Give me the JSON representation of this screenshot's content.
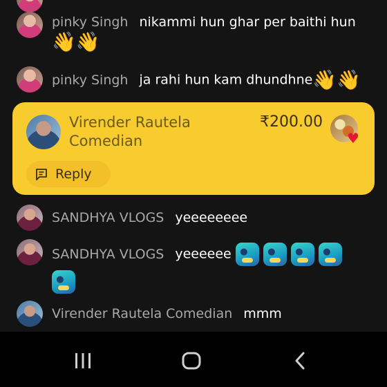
{
  "messages": [
    {
      "user": "pinky Singh",
      "text": "nikammi hun ghar per baithi hun",
      "emoji": "👋👋"
    },
    {
      "user": "pinky Singh",
      "text": "ja rahi hun kam dhundhne",
      "emoji": "👋👋"
    },
    {
      "user": "SANDHYA VLOGS",
      "text": "yeeeeeeee"
    },
    {
      "user": "SANDHYA VLOGS",
      "text": "yeeeeee"
    },
    {
      "user": "Virender Rautela Comedian",
      "text": "mmm"
    }
  ],
  "superchat": {
    "user": "Virender Rautela Comedian",
    "amount": "₹200.00",
    "reply_label": "Reply"
  },
  "colors": {
    "background": "#141414",
    "superchat_bg": "#f8cb2e",
    "username": "#a9a9a9",
    "navbar": "#000000"
  },
  "icons": {
    "recent_apps": "recent-apps-icon",
    "home": "home-icon",
    "back": "back-icon"
  }
}
